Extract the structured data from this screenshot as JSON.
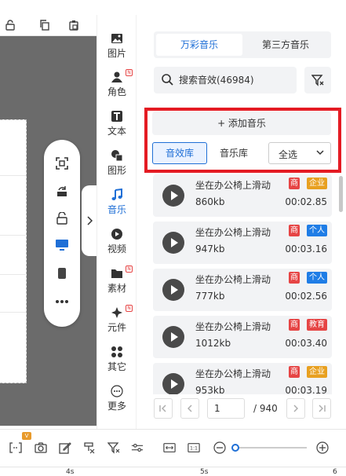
{
  "rail": {
    "items": [
      {
        "label": "图片",
        "icon": "image-icon"
      },
      {
        "label": "角色",
        "icon": "person-icon",
        "badge": "N"
      },
      {
        "label": "文本",
        "icon": "text-icon"
      },
      {
        "label": "图形",
        "icon": "shape-icon"
      },
      {
        "label": "音乐",
        "icon": "music-icon",
        "active": true
      },
      {
        "label": "视频",
        "icon": "video-icon"
      },
      {
        "label": "素材",
        "icon": "folder-icon",
        "badge": "N"
      },
      {
        "label": "元件",
        "icon": "component-icon",
        "badge": "N"
      },
      {
        "label": "其它",
        "icon": "grid-icon"
      },
      {
        "label": "更多",
        "icon": "more-icon"
      }
    ]
  },
  "panel": {
    "tabs": [
      "万彩音乐",
      "第三方音乐"
    ],
    "search_placeholder": "搜索音效(46984)",
    "add_music": "+ 添加音乐",
    "lib_effects": "音效库",
    "lib_music": "音乐库",
    "select_value": "全选",
    "tracks": [
      {
        "title": "坐在办公椅上滑动",
        "size": "860kb",
        "duration": "00:02.85",
        "badge1": "商",
        "badge2": "企业",
        "badge2_color": "#e8a020"
      },
      {
        "title": "坐在办公椅上滑动",
        "size": "947kb",
        "duration": "00:03.16",
        "badge1": "商",
        "badge2": "个人",
        "badge2_color": "#1f7de6"
      },
      {
        "title": "坐在办公椅上滑动",
        "size": "777kb",
        "duration": "00:02.56",
        "badge1": "商",
        "badge2": "个人",
        "badge2_color": "#1f7de6"
      },
      {
        "title": "坐在办公椅上滑动",
        "size": "1012kb",
        "duration": "00:03.40",
        "badge1": "商",
        "badge2": "教育",
        "badge2_color": "#e64545"
      },
      {
        "title": "坐在办公椅上滑动",
        "size": "953kb",
        "duration": "00:03.19",
        "badge1": "商",
        "badge2": "企业",
        "badge2_color": "#e8a020"
      }
    ],
    "pager": {
      "current": "1",
      "total": "/ 940"
    }
  },
  "timeline": {
    "marks": [
      "4s",
      "5s",
      "6"
    ]
  },
  "colors": {
    "accent": "#1f6fd6",
    "highlight": "#e41b23",
    "canvas_bg": "#6b6b6b"
  }
}
